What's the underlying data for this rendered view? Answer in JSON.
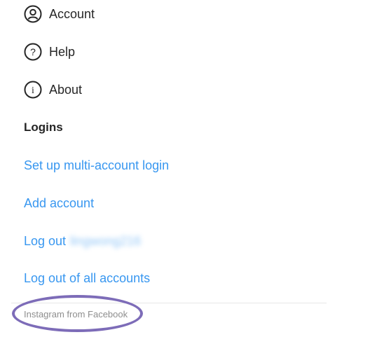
{
  "menu": {
    "account_label": "Account",
    "help_label": "Help",
    "about_label": "About"
  },
  "logins": {
    "section_title": "Logins",
    "multi_account_label": "Set up multi-account login",
    "add_account_label": "Add account",
    "log_out_prefix": "Log out",
    "username_obscured": "lingwong216",
    "log_out_all_label": "Log out of all accounts"
  },
  "footer": {
    "text": "Instagram from Facebook"
  },
  "icons": {
    "account": "user-circle-icon",
    "help": "question-circle-icon",
    "about": "info-circle-icon"
  },
  "colors": {
    "text_primary": "#262626",
    "link_blue": "#3897f0",
    "footer_gray": "#8e8e8e",
    "annotation_purple": "#7d6cb8"
  }
}
